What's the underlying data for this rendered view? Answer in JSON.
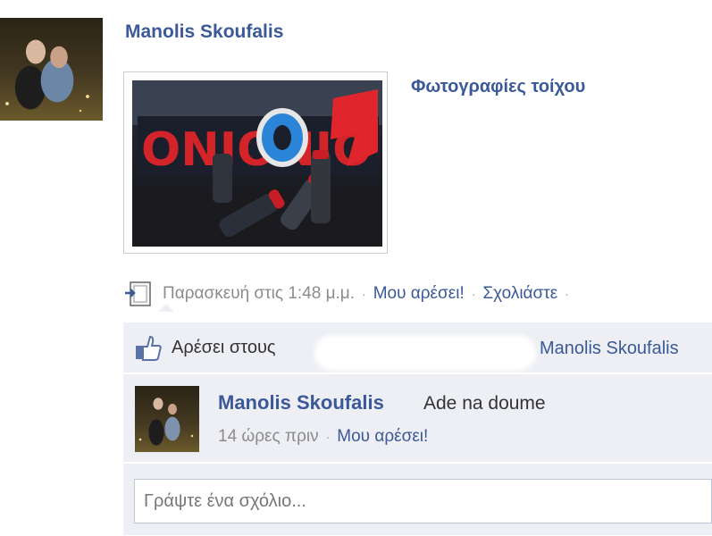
{
  "post": {
    "author": "Manolis Skoufalis",
    "album_link": "Φωτογραφίες τοίχου",
    "photo_text": "ONIONIO",
    "timestamp": "Παρασκευή στις 1:48 μ.μ.",
    "like_action": "Μου αρέσει!",
    "comment_action": "Σχολιάστε",
    "separator": "·"
  },
  "likes": {
    "prefix": "Αρέσει στους",
    "name": "Manolis Skoufalis"
  },
  "comment": {
    "author": "Manolis Skoufalis",
    "text": "Ade na doume",
    "time": "14 ώρες πριν",
    "like_action": "Μου αρέσει!"
  },
  "composer": {
    "placeholder": "Γράψτε ένα σχόλιο..."
  },
  "icons": {
    "share": "share-icon",
    "like": "like-thumb-icon"
  },
  "colors": {
    "link": "#3b5998",
    "ufi_bg": "#edeff4",
    "muted": "#8c8c8c"
  }
}
